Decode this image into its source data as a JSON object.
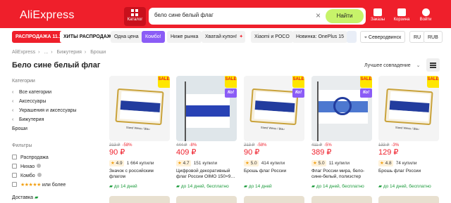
{
  "header": {
    "logo": "AliExpress",
    "catalog_label": "Каталог",
    "search_value": "бело сине белый флаг",
    "find_label": "Найти",
    "orders_label": "Заказы",
    "cart_label": "Корзина",
    "login_label": "Войти",
    "brand_color": "#ef1f2b"
  },
  "chips": [
    {
      "label": "РАСПРОДАЖА 11.11"
    },
    {
      "label": "ХИТЫ РАСПРОДАЖИ"
    },
    {
      "label": "Одна цена"
    },
    {
      "label": "Комбо!"
    },
    {
      "label": "Ниже рынка"
    },
    {
      "label": "Хватай купон!"
    },
    {
      "label": "Xiaomi и POCO"
    },
    {
      "label": "Новинка: OnePlus 15"
    }
  ],
  "location": "Северодвинск",
  "lang": "RU",
  "currency": "RUB",
  "breadcrumb": [
    "AliExpress",
    "...",
    "Бижутерия",
    "Броши"
  ],
  "page_title": "Бело сине белый флаг",
  "sort_label": "Лучшее совпадение",
  "sidebar": {
    "category_heading": "Категории",
    "categories": [
      "Все категории",
      "Аксессуары",
      "Украшения и аксессуары",
      "Бижутерия",
      "Броши"
    ],
    "filters_heading": "Фильтры",
    "filters": [
      "Распродажа",
      "Нихао",
      "Комбо",
      "или более"
    ],
    "delivery_heading": "Доставка"
  },
  "products": [
    {
      "old_price": "213 ₽",
      "discount": "-58%",
      "price": "90 ₽",
      "rating": "4.9",
      "sold": "1 664 купили",
      "name": "Значок с российским флагом",
      "delivery": "до 14 дней",
      "sale": true,
      "kombo": false,
      "image": "pin-flag"
    },
    {
      "old_price": "444 ₽",
      "discount": "-8%",
      "price": "409 ₽",
      "rating": "4.7",
      "sold": "151 купили",
      "name": "Цифровой декоративный флаг России ОІМО 150×9…",
      "delivery": "до 14 дней, бесплатно",
      "sale": true,
      "kombo": true,
      "image": "flag-pole"
    },
    {
      "old_price": "213 ₽",
      "discount": "-58%",
      "price": "90 ₽",
      "rating": "5.0",
      "sold": "414 купили",
      "name": "Брошь флаг России",
      "delivery": "до 14 дней",
      "sale": true,
      "kombo": true,
      "image": "pin-flag"
    },
    {
      "old_price": "411 ₽",
      "discount": "-5%",
      "price": "389 ₽",
      "rating": "5.0",
      "sold": "11 купили",
      "name": "Флаг России мира, бело-сине-белый, полиэстер",
      "delivery": "до 14 дней, бесплатно",
      "sale": true,
      "kombo": true,
      "image": "peace-flag"
    },
    {
      "old_price": "133 ₽",
      "discount": "-3%",
      "price": "129 ₽",
      "rating": "4.8",
      "sold": "74 купили",
      "name": "Брошь флаг России",
      "delivery": "до 14 дней, бесплатно",
      "sale": true,
      "kombo": false,
      "image": "pin-flag"
    }
  ],
  "badge_sale": "SALE",
  "badge_kombo": "Ко!",
  "pin_stand_text": "Stand Weiss / Blau"
}
